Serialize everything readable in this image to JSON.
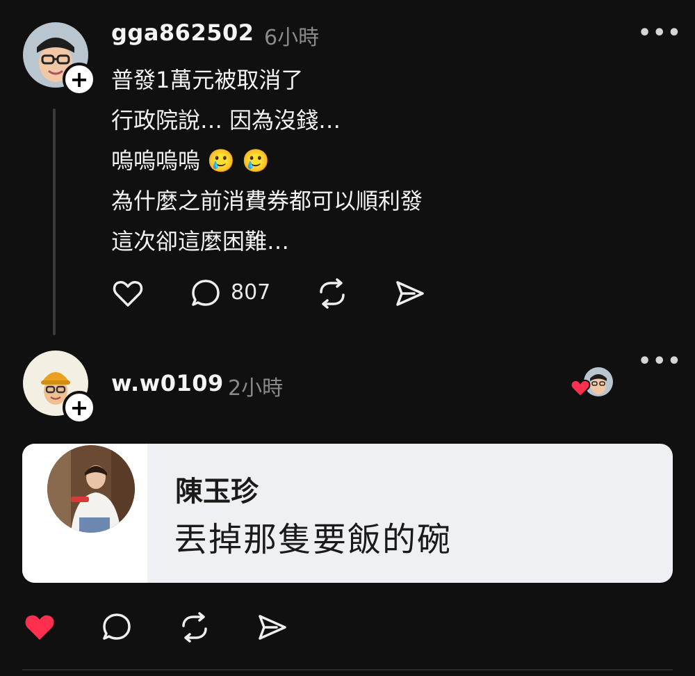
{
  "post1": {
    "username": "gga862502",
    "time": "6小時",
    "more": "•••",
    "lines": [
      "普發1萬元被取消了",
      "行政院說… 因為沒錢…",
      "嗚嗚嗚嗚",
      "為什麼之前消費券都可以順利發",
      "這次卻這麼困難…"
    ],
    "emoji_1": "🥲",
    "emoji_2": "🥲",
    "reply_count": "807"
  },
  "post2": {
    "username": "w.w0109",
    "time": "2小時",
    "more": "•••",
    "quote_name": "陳玉珍",
    "quote_text": "丟掉那隻要飯的碗"
  },
  "icons": {
    "avatar": "avatar",
    "follow": "plus-icon",
    "like": "heart-icon",
    "reply": "comment-icon",
    "repost": "repost-icon",
    "share": "send-icon",
    "liked": "heart-filled-icon"
  },
  "colors": {
    "background": "#101010",
    "like_red": "#ff2f4f",
    "muted": "#8a8a8a"
  }
}
